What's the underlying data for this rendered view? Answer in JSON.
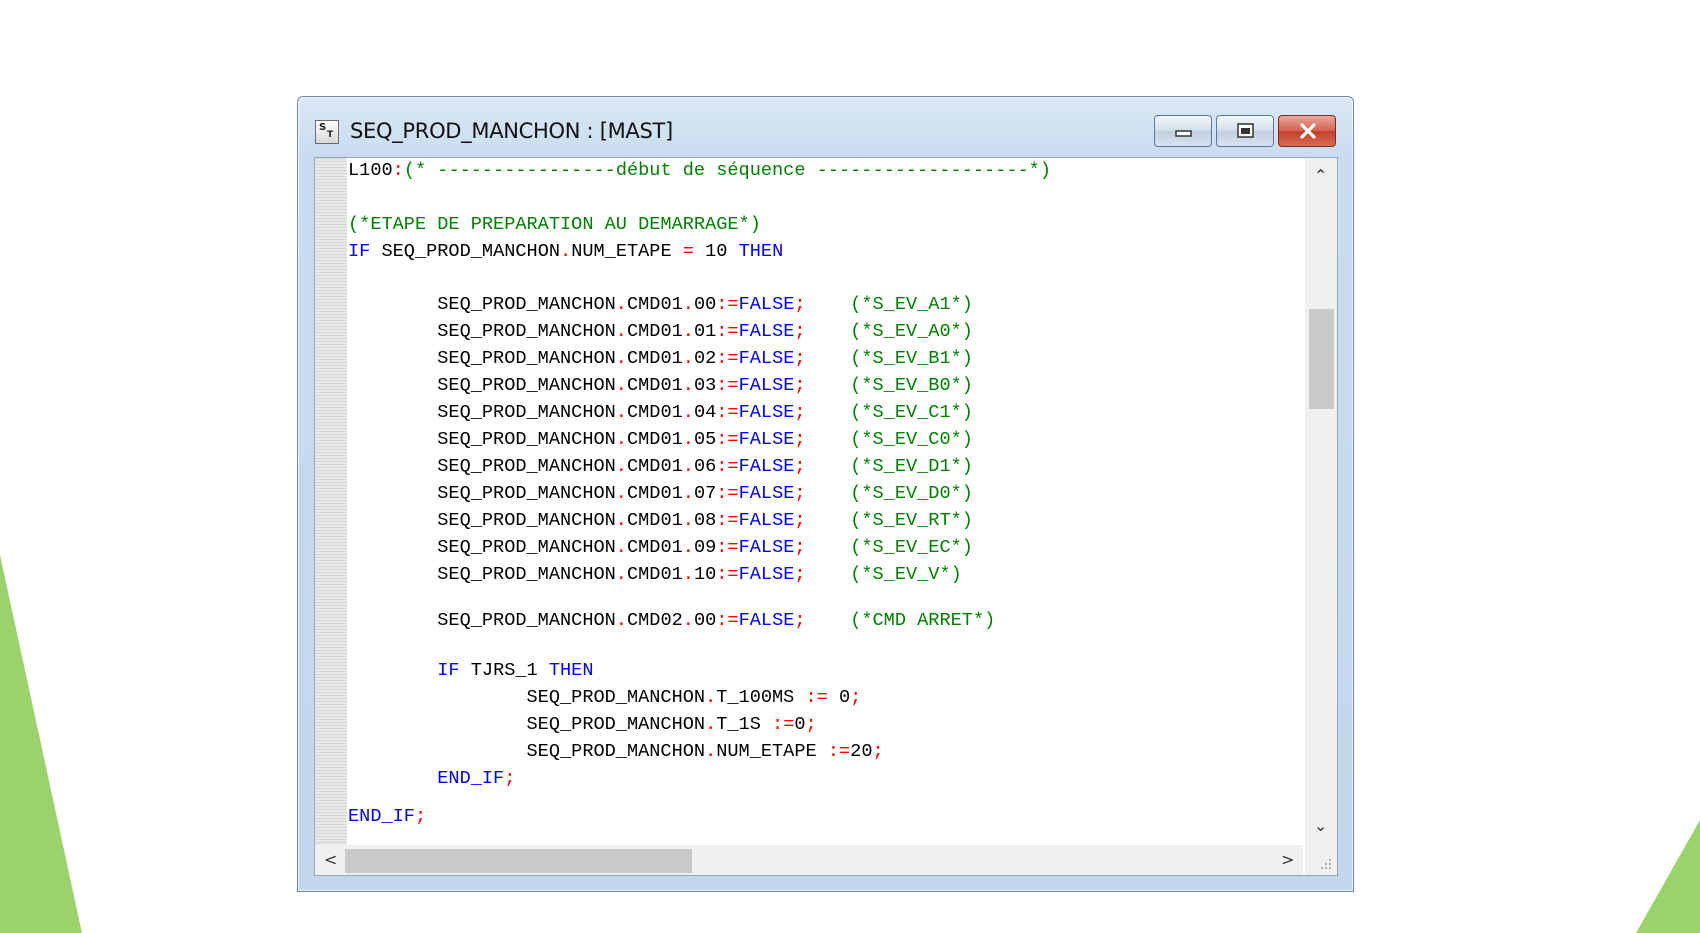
{
  "colors": {
    "accent_green": "#9bd36a",
    "keyword": "#0000ff",
    "operator": "#ff0000",
    "comment": "#008000",
    "plain": "#000000"
  },
  "window": {
    "icon": "structured-text-icon",
    "icon_letters": [
      "S",
      "T"
    ],
    "title": "SEQ_PROD_MANCHON : [MAST]",
    "controls": [
      {
        "name": "minimize-icon",
        "glyph": "▭"
      },
      {
        "name": "maximize-icon",
        "glyph": "▣"
      },
      {
        "name": "close-icon",
        "glyph": "✕"
      }
    ]
  },
  "scrollbars": {
    "up_arrow": "⌃",
    "down_arrow": "⌄",
    "left_arrow": "<",
    "right_arrow": ">",
    "vertical_thumb_fraction": 0.15,
    "horizontal_thumb_fraction": 0.35
  },
  "code_lines": [
    [
      {
        "t": "L100",
        "c": "plain"
      },
      {
        "t": ":",
        "c": "operator"
      },
      {
        "t": "(* ----------------début de séquence -------------------*)",
        "c": "comment"
      }
    ],
    [],
    [
      {
        "t": "(*ETAPE DE PREPARATION AU DEMARRAGE*)",
        "c": "comment"
      }
    ],
    [
      {
        "t": "IF",
        "c": "keyword"
      },
      {
        "t": " SEQ_PROD_MANCHON",
        "c": "plain"
      },
      {
        "t": ".",
        "c": "operator"
      },
      {
        "t": "NUM_ETAPE ",
        "c": "plain"
      },
      {
        "t": "=",
        "c": "operator"
      },
      {
        "t": " 10 ",
        "c": "plain"
      },
      {
        "t": "THEN",
        "c": "keyword"
      }
    ],
    [],
    [
      {
        "t": "        SEQ_PROD_MANCHON",
        "c": "plain"
      },
      {
        "t": ".",
        "c": "operator"
      },
      {
        "t": "CMD01",
        "c": "plain"
      },
      {
        "t": ".",
        "c": "operator"
      },
      {
        "t": "00",
        "c": "plain"
      },
      {
        "t": ":=",
        "c": "operator"
      },
      {
        "t": "FALSE",
        "c": "keyword"
      },
      {
        "t": ";",
        "c": "operator"
      },
      {
        "t": "    ",
        "c": "plain"
      },
      {
        "t": "(*S_EV_A1*)",
        "c": "comment"
      }
    ],
    [
      {
        "t": "        SEQ_PROD_MANCHON",
        "c": "plain"
      },
      {
        "t": ".",
        "c": "operator"
      },
      {
        "t": "CMD01",
        "c": "plain"
      },
      {
        "t": ".",
        "c": "operator"
      },
      {
        "t": "01",
        "c": "plain"
      },
      {
        "t": ":=",
        "c": "operator"
      },
      {
        "t": "FALSE",
        "c": "keyword"
      },
      {
        "t": ";",
        "c": "operator"
      },
      {
        "t": "    ",
        "c": "plain"
      },
      {
        "t": "(*S_EV_A0*)",
        "c": "comment"
      }
    ],
    [
      {
        "t": "        SEQ_PROD_MANCHON",
        "c": "plain"
      },
      {
        "t": ".",
        "c": "operator"
      },
      {
        "t": "CMD01",
        "c": "plain"
      },
      {
        "t": ".",
        "c": "operator"
      },
      {
        "t": "02",
        "c": "plain"
      },
      {
        "t": ":=",
        "c": "operator"
      },
      {
        "t": "FALSE",
        "c": "keyword"
      },
      {
        "t": ";",
        "c": "operator"
      },
      {
        "t": "    ",
        "c": "plain"
      },
      {
        "t": "(*S_EV_B1*)",
        "c": "comment"
      }
    ],
    [
      {
        "t": "        SEQ_PROD_MANCHON",
        "c": "plain"
      },
      {
        "t": ".",
        "c": "operator"
      },
      {
        "t": "CMD01",
        "c": "plain"
      },
      {
        "t": ".",
        "c": "operator"
      },
      {
        "t": "03",
        "c": "plain"
      },
      {
        "t": ":=",
        "c": "operator"
      },
      {
        "t": "FALSE",
        "c": "keyword"
      },
      {
        "t": ";",
        "c": "operator"
      },
      {
        "t": "    ",
        "c": "plain"
      },
      {
        "t": "(*S_EV_B0*)",
        "c": "comment"
      }
    ],
    [
      {
        "t": "        SEQ_PROD_MANCHON",
        "c": "plain"
      },
      {
        "t": ".",
        "c": "operator"
      },
      {
        "t": "CMD01",
        "c": "plain"
      },
      {
        "t": ".",
        "c": "operator"
      },
      {
        "t": "04",
        "c": "plain"
      },
      {
        "t": ":=",
        "c": "operator"
      },
      {
        "t": "FALSE",
        "c": "keyword"
      },
      {
        "t": ";",
        "c": "operator"
      },
      {
        "t": "    ",
        "c": "plain"
      },
      {
        "t": "(*S_EV_C1*)",
        "c": "comment"
      }
    ],
    [
      {
        "t": "        SEQ_PROD_MANCHON",
        "c": "plain"
      },
      {
        "t": ".",
        "c": "operator"
      },
      {
        "t": "CMD01",
        "c": "plain"
      },
      {
        "t": ".",
        "c": "operator"
      },
      {
        "t": "05",
        "c": "plain"
      },
      {
        "t": ":=",
        "c": "operator"
      },
      {
        "t": "FALSE",
        "c": "keyword"
      },
      {
        "t": ";",
        "c": "operator"
      },
      {
        "t": "    ",
        "c": "plain"
      },
      {
        "t": "(*S_EV_C0*)",
        "c": "comment"
      }
    ],
    [
      {
        "t": "        SEQ_PROD_MANCHON",
        "c": "plain"
      },
      {
        "t": ".",
        "c": "operator"
      },
      {
        "t": "CMD01",
        "c": "plain"
      },
      {
        "t": ".",
        "c": "operator"
      },
      {
        "t": "06",
        "c": "plain"
      },
      {
        "t": ":=",
        "c": "operator"
      },
      {
        "t": "FALSE",
        "c": "keyword"
      },
      {
        "t": ";",
        "c": "operator"
      },
      {
        "t": "    ",
        "c": "plain"
      },
      {
        "t": "(*S_EV_D1*)",
        "c": "comment"
      }
    ],
    [
      {
        "t": "        SEQ_PROD_MANCHON",
        "c": "plain"
      },
      {
        "t": ".",
        "c": "operator"
      },
      {
        "t": "CMD01",
        "c": "plain"
      },
      {
        "t": ".",
        "c": "operator"
      },
      {
        "t": "07",
        "c": "plain"
      },
      {
        "t": ":=",
        "c": "operator"
      },
      {
        "t": "FALSE",
        "c": "keyword"
      },
      {
        "t": ";",
        "c": "operator"
      },
      {
        "t": "    ",
        "c": "plain"
      },
      {
        "t": "(*S_EV_D0*)",
        "c": "comment"
      }
    ],
    [
      {
        "t": "        SEQ_PROD_MANCHON",
        "c": "plain"
      },
      {
        "t": ".",
        "c": "operator"
      },
      {
        "t": "CMD01",
        "c": "plain"
      },
      {
        "t": ".",
        "c": "operator"
      },
      {
        "t": "08",
        "c": "plain"
      },
      {
        "t": ":=",
        "c": "operator"
      },
      {
        "t": "FALSE",
        "c": "keyword"
      },
      {
        "t": ";",
        "c": "operator"
      },
      {
        "t": "    ",
        "c": "plain"
      },
      {
        "t": "(*S_EV_RT*)",
        "c": "comment"
      }
    ],
    [
      {
        "t": "        SEQ_PROD_MANCHON",
        "c": "plain"
      },
      {
        "t": ".",
        "c": "operator"
      },
      {
        "t": "CMD01",
        "c": "plain"
      },
      {
        "t": ".",
        "c": "operator"
      },
      {
        "t": "09",
        "c": "plain"
      },
      {
        "t": ":=",
        "c": "operator"
      },
      {
        "t": "FALSE",
        "c": "keyword"
      },
      {
        "t": ";",
        "c": "operator"
      },
      {
        "t": "    ",
        "c": "plain"
      },
      {
        "t": "(*S_EV_EC*)",
        "c": "comment"
      }
    ],
    [
      {
        "t": "        SEQ_PROD_MANCHON",
        "c": "plain"
      },
      {
        "t": ".",
        "c": "operator"
      },
      {
        "t": "CMD01",
        "c": "plain"
      },
      {
        "t": ".",
        "c": "operator"
      },
      {
        "t": "10",
        "c": "plain"
      },
      {
        "t": ":=",
        "c": "operator"
      },
      {
        "t": "FALSE",
        "c": "keyword"
      },
      {
        "t": ";",
        "c": "operator"
      },
      {
        "t": "    ",
        "c": "plain"
      },
      {
        "t": "(*S_EV_V*)",
        "c": "comment"
      }
    ],
    [],
    [
      {
        "t": "        SEQ_PROD_MANCHON",
        "c": "plain"
      },
      {
        "t": ".",
        "c": "operator"
      },
      {
        "t": "CMD02",
        "c": "plain"
      },
      {
        "t": ".",
        "c": "operator"
      },
      {
        "t": "00",
        "c": "plain"
      },
      {
        "t": ":=",
        "c": "operator"
      },
      {
        "t": "FALSE",
        "c": "keyword"
      },
      {
        "t": ";",
        "c": "operator"
      },
      {
        "t": "    ",
        "c": "plain"
      },
      {
        "t": "(*CMD ARRET*)",
        "c": "comment"
      }
    ],
    [],
    [
      {
        "t": "        ",
        "c": "plain"
      },
      {
        "t": "IF",
        "c": "keyword"
      },
      {
        "t": " TJRS_1 ",
        "c": "plain"
      },
      {
        "t": "THEN",
        "c": "keyword"
      }
    ],
    [
      {
        "t": "                SEQ_PROD_MANCHON",
        "c": "plain"
      },
      {
        "t": ".",
        "c": "operator"
      },
      {
        "t": "T_100MS ",
        "c": "plain"
      },
      {
        "t": ":=",
        "c": "operator"
      },
      {
        "t": " 0",
        "c": "plain"
      },
      {
        "t": ";",
        "c": "operator"
      }
    ],
    [
      {
        "t": "                SEQ_PROD_MANCHON",
        "c": "plain"
      },
      {
        "t": ".",
        "c": "operator"
      },
      {
        "t": "T_1S ",
        "c": "plain"
      },
      {
        "t": ":=",
        "c": "operator"
      },
      {
        "t": "0",
        "c": "plain"
      },
      {
        "t": ";",
        "c": "operator"
      }
    ],
    [
      {
        "t": "                SEQ_PROD_MANCHON",
        "c": "plain"
      },
      {
        "t": ".",
        "c": "operator"
      },
      {
        "t": "NUM_ETAPE ",
        "c": "plain"
      },
      {
        "t": ":=",
        "c": "operator"
      },
      {
        "t": "20",
        "c": "plain"
      },
      {
        "t": ";",
        "c": "operator"
      }
    ],
    [
      {
        "t": "        ",
        "c": "plain"
      },
      {
        "t": "END_IF",
        "c": "keyword"
      },
      {
        "t": ";",
        "c": "operator"
      }
    ],
    [
      {
        "t": "END_IF",
        "c": "keyword"
      },
      {
        "t": ";",
        "c": "operator"
      }
    ]
  ]
}
